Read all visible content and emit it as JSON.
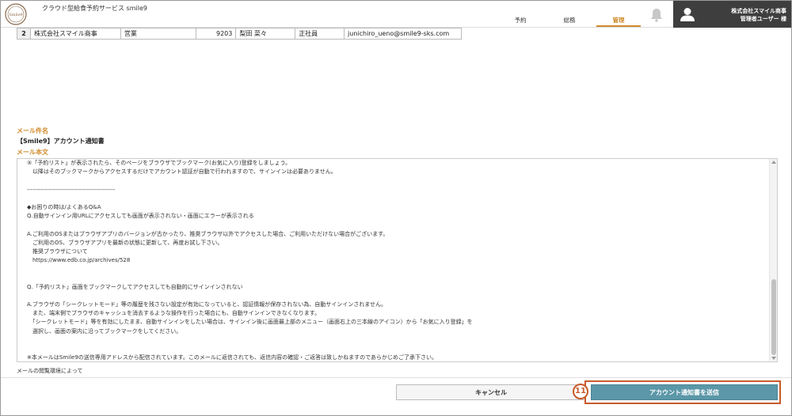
{
  "header": {
    "logo_text": "Smile9",
    "app_title": "クラウド型給食予約サービス smile9",
    "tabs": [
      {
        "label": "予約"
      },
      {
        "label": "総務"
      },
      {
        "label": "管理"
      }
    ],
    "active_tab": "管理",
    "company": "株式会社スマイル商事",
    "user": "管理者ユーザー 様"
  },
  "table_row": {
    "no": "2",
    "company": "株式会社スマイル商事",
    "dept": "営業",
    "code": "9203",
    "name": "梨田 菜々",
    "type": "正社員",
    "email": "junichiro_ueno@smile9-sks.com"
  },
  "mail": {
    "subject_label": "メール件名",
    "subject_value": "【Smile9】アカウント通知書",
    "body_label": "メール本文",
    "body_lines": [
      "⑤「予約リスト」が表示されたら、そのページをブラウザでブックマーク(お気に入り)登録をしましょう。",
      "　以降はそのブックマークからアクセスするだけでアカウント認証が自動で行われますので、サインインは必要ありません。",
      "",
      "--------------------------------------------",
      "",
      "◆お困りの時は/よくあるQ&A",
      "Q.自動サインイン用URLにアクセスしても画面が表示されない・画面にエラーが表示される",
      "",
      "A.ご利用のOSまたはブラウザアプリのバージョンが古かったり、推奨ブラウザ以外でアクセスした場合、ご利用いただけない場合がございます。",
      "　ご利用のOS、ブラウザアプリを最新の状態に更新して、再度お試し下さい。",
      "　推奨ブラウザについて",
      "　https://www.edb.co.jp/archives/528",
      "",
      "",
      "Q.「予約リスト」画面をブックマークしてアクセスしても自動的にサインインされない",
      "",
      "A.ブラウザの「シークレットモード」等の履歴を残さない設定が有効になっていると、認証情報が保存されない為、自動サインインされません。",
      "　また、端末側でブラウザのキャッシュを消去するような操作を行った場合にも、自動サインインできなくなります。",
      "　「シークレットモード」等を有効にしたまま、自動サインインをしたい場合は、サインイン後に画面最上部のメニュー（画面右上の三本線のアイコン）から「お気に入り登録」を",
      "　選択し、画面の案内に沿ってブックマークをしてください。",
      "",
      "",
      "※本メールはSmile9の送信専用アドレスから配信されています。このメールに返信されても、返信内容の確認・ご返答は致しかねますのであらかじめご了承下さい。"
    ],
    "footnote": "メールの閲覧環境によって"
  },
  "buttons": {
    "cancel": "キャンセル",
    "send": "アカウント通知書を送信",
    "step_number": "11"
  },
  "colors": {
    "accent": "#d08a2a",
    "send_button": "#5b97a8",
    "highlight": "#c85a2a",
    "user_panel": "#3e3e3e"
  }
}
